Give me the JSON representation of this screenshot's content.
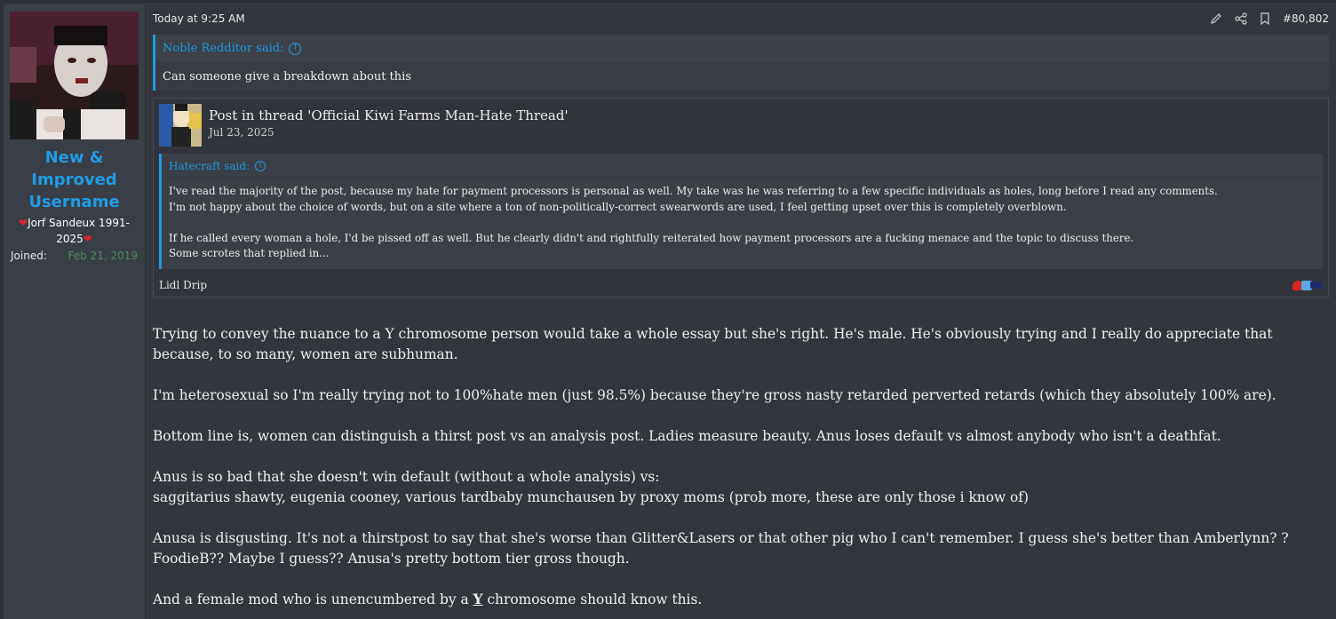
{
  "user": {
    "name": "New & Improved Username",
    "title_text": "Jorf Sandeux 1991-2025",
    "joined_label": "Joined:",
    "joined_value": "Feb 21, 2019",
    "avatar_icon": "avatar-image"
  },
  "post": {
    "timestamp": "Today at 9:25 AM",
    "number": "#80,802",
    "action_icons": [
      "edit-icon",
      "share-icon",
      "bookmark-icon"
    ]
  },
  "quote": {
    "author_label": "Noble Redditor said:",
    "text": "Can someone give a breakdown about this"
  },
  "embed": {
    "title": "Post in thread 'Official Kiwi Farms Man-Hate Thread'",
    "date": "Jul 23, 2025",
    "quote_author": "Hatecraft said:",
    "quote_lines": [
      "I've read the majority of the post, because my hate for payment processors is personal as well. My take was he was referring to a few specific individuals as holes, long before I read any comments.",
      "I'm not happy about the choice of words, but on a site where a ton of non-politically-correct swearwords are used, I feel getting upset over this is completely overblown.",
      "If he called every woman a hole, I'd be pissed off as well. But he clearly didn't and rightfully reiterated how payment processors are a fucking menace and the topic to discuss there.",
      "Some scrotes that replied in..."
    ],
    "footer_author": "Lidl Drip",
    "reaction_icons": [
      "heart-icon",
      "like-icon",
      "hat-icon"
    ]
  },
  "body": {
    "p1": "Trying to convey the nuance to a Y chromosome person would take a whole essay but she's right. He's male. He's obviously trying and I really do appreciate that because, to so many, women are subhuman.",
    "p2": "I'm heterosexual so I'm really trying not to 100%hate men (just 98.5%) because they're gross nasty retarded perverted retards (which they absolutely 100% are).",
    "p3": "Bottom line is, women can distinguish a thirst post vs an analysis post. Ladies measure beauty. Anus loses default vs almost anybody who isn't a deathfat.",
    "p4a": "Anus is so bad that she doesn't win default (without a whole analysis) vs:",
    "p4b": "saggitarius shawty, eugenia cooney, various tardbaby munchausen by proxy moms (prob more, these are only those i know of)",
    "p5": "Anusa is disgusting. It's not a thirstpost to say that she's worse than Glitter&Lasers or that other pig who I can't remember. I guess she's better than Amberlynn? ? FoodieB?? Maybe I guess?? Anusa's pretty bottom tier gross though.",
    "p6_pre": "And a female mod who is unencumbered by a ",
    "p6_mark": "Y",
    "p6_post": " chromosome should know this."
  },
  "colors": {
    "accent": "#1f9ce6",
    "heart": "#e0252b",
    "joined_date": "#4f8f5e"
  }
}
